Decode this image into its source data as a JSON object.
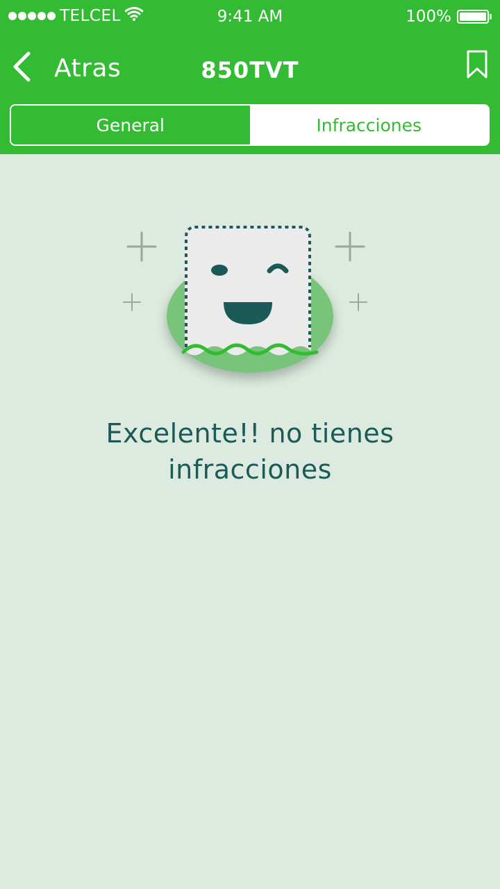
{
  "status_bar": {
    "carrier": "TELCEL",
    "time": "9:41 AM",
    "battery": "100%",
    "signal_bars": 5,
    "icons": [
      "signal-dots-icon",
      "wifi-icon",
      "battery-icon"
    ]
  },
  "nav": {
    "back_label": "Atras",
    "title": "850TVT",
    "icons": [
      "chevron-left-icon",
      "bookmark-icon"
    ]
  },
  "tabs": [
    {
      "label": "General",
      "selected": false
    },
    {
      "label": "Infracciones",
      "selected": true
    }
  ],
  "empty_state": {
    "message": "Excelente!! no tienes infracciones",
    "illustration": "happy-ticket-icon"
  },
  "colors": {
    "brand_green": "#33bb33",
    "background": "#dceadf",
    "text_dark_teal": "#1c5a57"
  }
}
